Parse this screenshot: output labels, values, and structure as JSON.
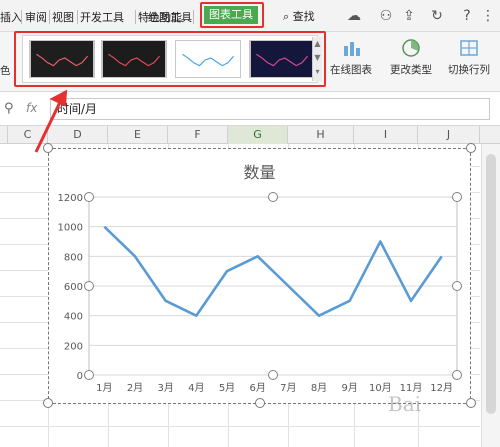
{
  "menu": {
    "tabs": [
      {
        "label": "插入"
      },
      {
        "label": "审阅"
      },
      {
        "label": "视图"
      },
      {
        "label": "开发工具"
      },
      {
        "label": "特色功能"
      },
      {
        "label": "绘图工具"
      }
    ],
    "active_tab": "图表工具",
    "search_label": "查找"
  },
  "ribbon": {
    "left_stub": "色",
    "online_chart": "在线图表",
    "change_type": "更改类型",
    "switch_rowcol": "切换行列",
    "styles": [
      {
        "bg": "#1e1e1e",
        "line": "#e8606c"
      },
      {
        "bg": "#1c1c1c",
        "line": "#e8495a"
      },
      {
        "bg": "#ffffff",
        "line": "#4aa3df"
      },
      {
        "bg": "#15163b",
        "line": "#d94a8e"
      }
    ]
  },
  "formula": {
    "fx_label": "fx",
    "value": "时间/月"
  },
  "columns": [
    "C",
    "D",
    "E",
    "F",
    "G",
    "H",
    "I",
    "J"
  ],
  "active_column": "G",
  "chart_data": {
    "type": "line",
    "title": "数量",
    "categories": [
      "1月",
      "2月",
      "3月",
      "4月",
      "5月",
      "6月",
      "7月",
      "8月",
      "9月",
      "10月",
      "11月",
      "12月"
    ],
    "values": [
      1000,
      800,
      500,
      400,
      700,
      800,
      600,
      400,
      500,
      900,
      500,
      800
    ],
    "ylim": [
      0,
      1200
    ],
    "yticks": [
      0,
      200,
      400,
      600,
      800,
      1000,
      1200
    ],
    "grid": true,
    "line_color": "#5b9bd5"
  },
  "watermark": "Bai"
}
